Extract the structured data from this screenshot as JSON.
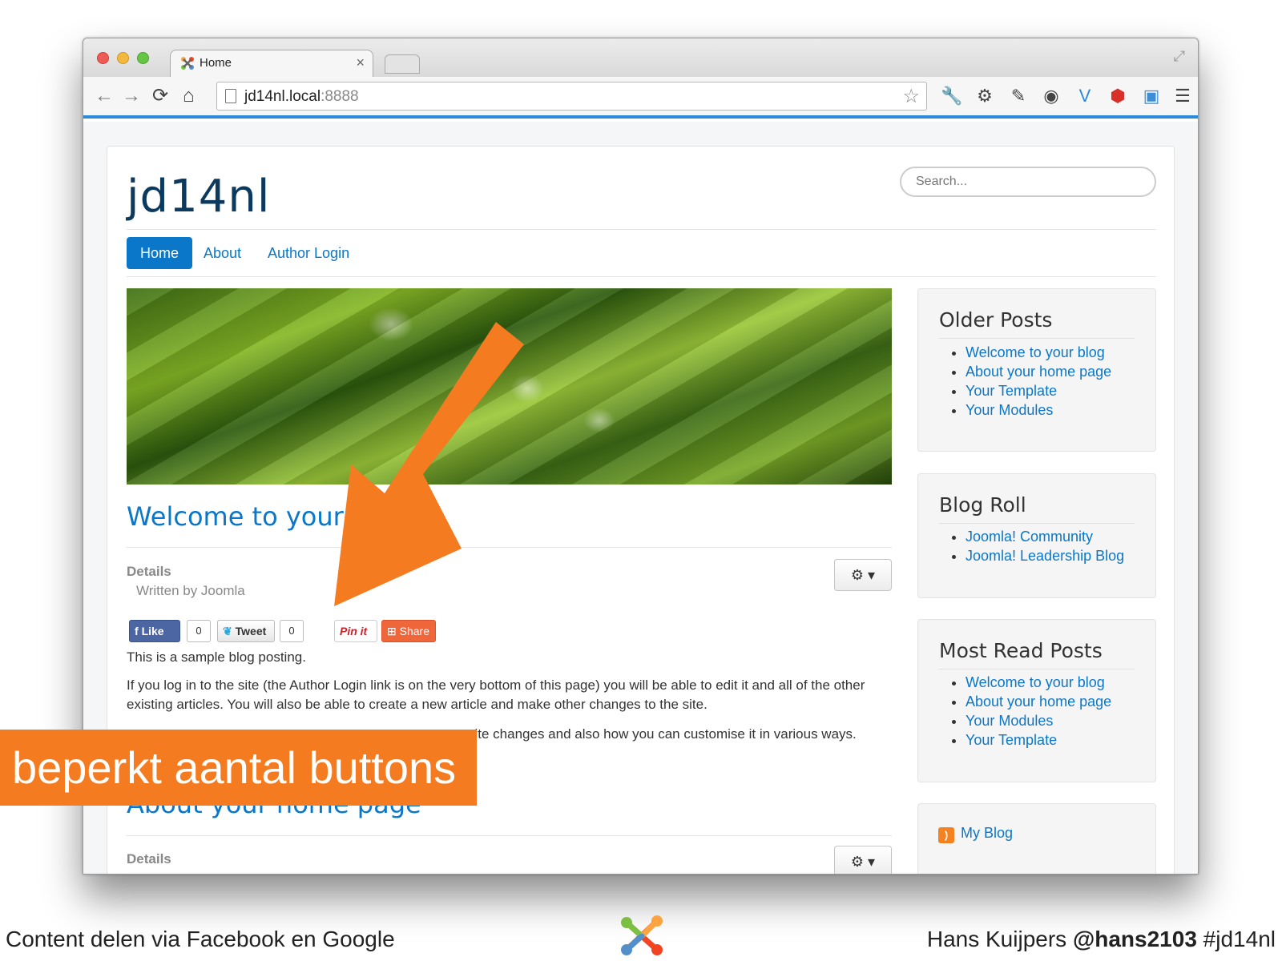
{
  "browser": {
    "tab_title": "Home",
    "tab_close": "×",
    "url_host": "jd14nl.local",
    "url_port": ":8888",
    "nav": {
      "back": "←",
      "forward": "→",
      "reload": "⟳",
      "home": "⌂"
    },
    "extensions": [
      "wrench-icon",
      "gear-icon",
      "eyedropper-icon",
      "color-wheel-icon",
      "v-icon",
      "shield-icon",
      "screen-icon",
      "menu-icon"
    ]
  },
  "site": {
    "brand": "jd14nl",
    "search_placeholder": "Search...",
    "nav": [
      {
        "label": "Home"
      },
      {
        "label": "About"
      },
      {
        "label": "Author Login"
      }
    ]
  },
  "article1": {
    "title": "Welcome to your",
    "details": "Details",
    "written_by": "Written by Joomla",
    "share": {
      "like": "Like",
      "like_count": "0",
      "tweet": "Tweet",
      "tweet_count": "0",
      "pin": "Pin it",
      "share": "Share"
    },
    "para1": "This is a sample blog posting.",
    "para2": "If you log in to the site (the Author Login link is on the very bottom of this page) you will be able to edit it and all of the other existing articles. You will also be able to create a new article and make other changes to the site.",
    "para3_visible": "site changes and also how you can customise it in various ways."
  },
  "article2": {
    "title": "About your home page",
    "details": "Details"
  },
  "sidebar": {
    "older_posts": {
      "title": "Older Posts",
      "items": [
        "Welcome to your blog",
        "About your home page",
        "Your Template",
        "Your Modules"
      ]
    },
    "blog_roll": {
      "title": "Blog Roll",
      "items": [
        "Joomla! Community",
        "Joomla! Leadership Blog"
      ]
    },
    "most_read": {
      "title": "Most Read Posts",
      "items": [
        "Welcome to your blog",
        "About your home page",
        "Your Modules",
        "Your Template"
      ]
    },
    "feed": {
      "label": "My Blog"
    }
  },
  "slide": {
    "callout": "beperkt aantal buttons",
    "footer_left": "Content delen via Facebook en Google",
    "footer_right_name": "Hans Kuijpers ",
    "footer_right_handle": "@hans2103",
    "footer_right_tag": " #jd14nl",
    "accent_color": "#f47b20"
  }
}
